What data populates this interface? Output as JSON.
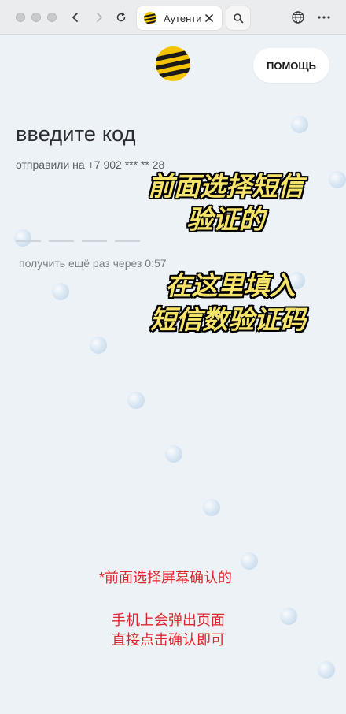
{
  "browser": {
    "tab_title": "Аутентифи",
    "icons": [
      "back-icon",
      "forward-icon",
      "reload-icon",
      "close-icon",
      "search-icon",
      "globe-icon",
      "more-icon"
    ]
  },
  "header": {
    "help_label": "ПОМОЩЬ"
  },
  "main": {
    "title": "введите код",
    "sent_to": "отправили на +7 902 *** ** 28",
    "resend": "получить ещё раз через 0:57",
    "code_slots": 4
  },
  "overlay": {
    "line1": "前面选择短信",
    "line2": "验证的",
    "line3": "在这里填入",
    "line4": "短信数验证码"
  },
  "note": {
    "line1": "*前面选择屏幕确认的",
    "line2": "手机上会弹出页面",
    "line3": "直接点击确认即可"
  },
  "colors": {
    "brand_yellow": "#f5c400",
    "accent_red": "#e0262d",
    "overlay_yellow": "#f6e36a"
  }
}
